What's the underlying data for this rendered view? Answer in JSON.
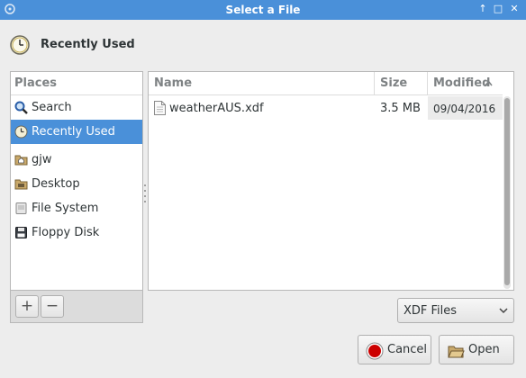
{
  "window": {
    "title": "Select a File"
  },
  "header": {
    "label": "Recently Used"
  },
  "places": {
    "heading": "Places",
    "items": [
      {
        "label": "Search",
        "icon": "search-icon"
      },
      {
        "label": "Recently Used",
        "icon": "clock-icon",
        "selected": true
      },
      {
        "label": "gjw",
        "icon": "home-folder-icon"
      },
      {
        "label": "Desktop",
        "icon": "desktop-folder-icon"
      },
      {
        "label": "File System",
        "icon": "drive-icon"
      },
      {
        "label": "Floppy Disk",
        "icon": "floppy-icon"
      }
    ],
    "add_symbol": "+",
    "remove_symbol": "−"
  },
  "files": {
    "columns": {
      "name": "Name",
      "size": "Size",
      "modified": "Modified"
    },
    "rows": [
      {
        "name": "weatherAUS.xdf",
        "size": "3.5 MB",
        "modified": "09/04/2016"
      }
    ]
  },
  "filter": {
    "selected": "XDF Files"
  },
  "buttons": {
    "cancel": "Cancel",
    "open": "Open"
  },
  "colors": {
    "accent": "#4a90d9",
    "cancel_red": "#cc0000"
  }
}
